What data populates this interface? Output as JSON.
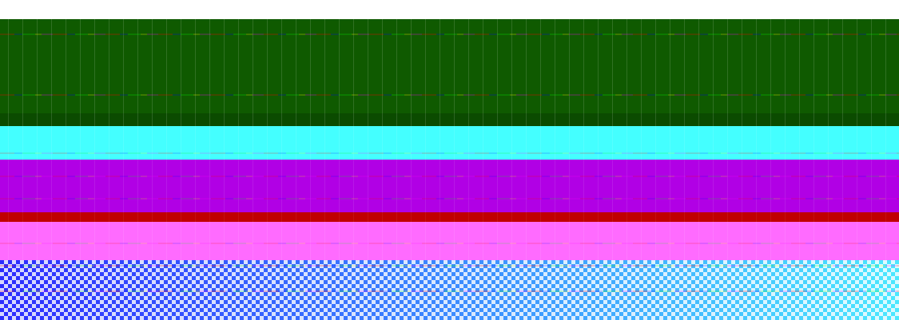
{
  "artifact": {
    "type": "corrupted-screenshot",
    "colors": {
      "white": "#ffffff",
      "dark_green": "#0f5a00",
      "green_dark_2": "#0b4b00",
      "cyan": "#44ffff",
      "magenta": "#b100e5",
      "pink": "#ff6bff",
      "red": "#c00000",
      "checker_blue": "#2c2cff",
      "checker_cyan": "#4be8ff"
    }
  }
}
